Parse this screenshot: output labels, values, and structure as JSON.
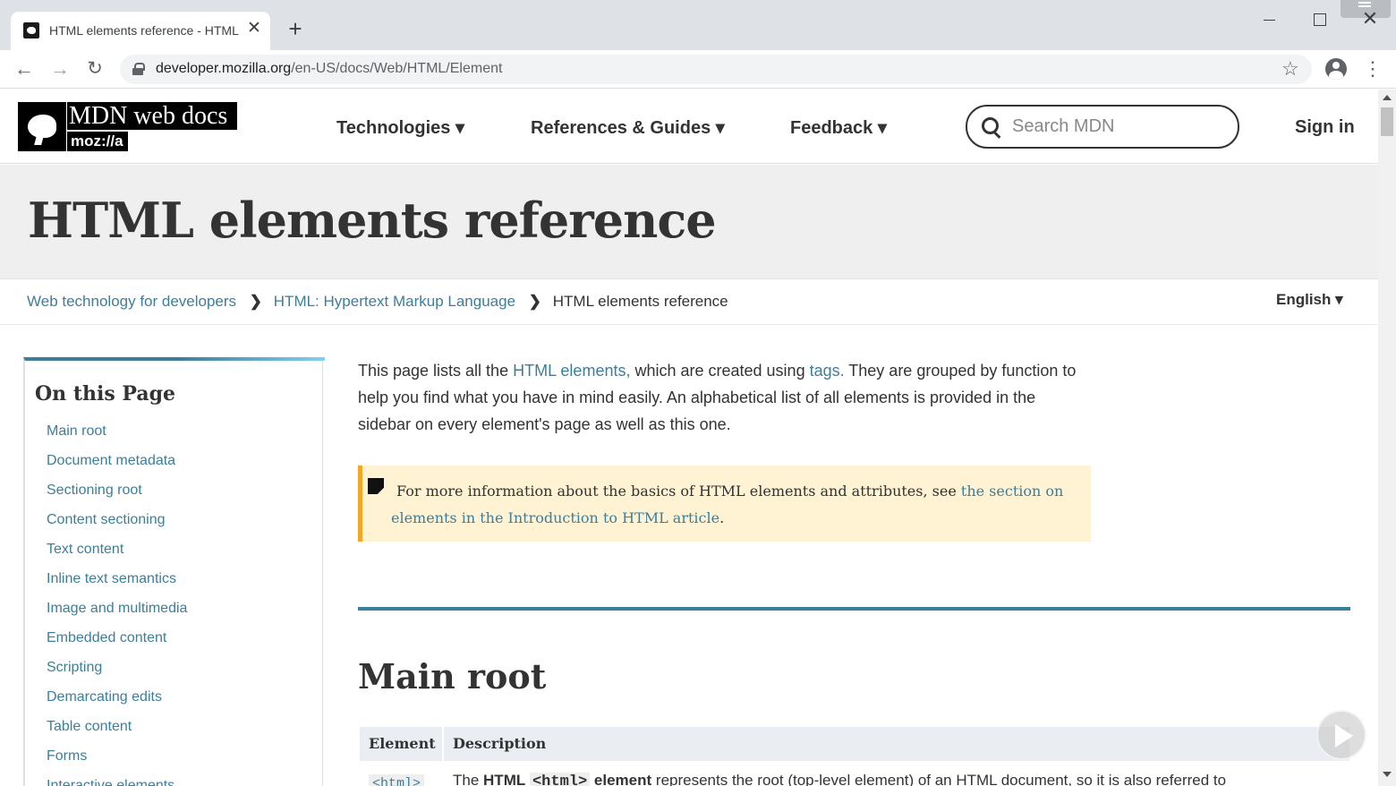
{
  "browser": {
    "tab_title": "HTML elements reference - HTML",
    "tab_close": "✕",
    "new_tab": "+",
    "url_host": "developer.mozilla.org",
    "url_path": "/en-US/docs/Web/HTML/Element",
    "icons": {
      "back": "arrow-left-icon",
      "forward": "arrow-right-icon",
      "reload": "reload-icon",
      "lock": "lock-icon",
      "star": "star-icon",
      "profile": "profile-icon",
      "menu": "kebab-menu-icon"
    },
    "glyphs": {
      "back": "←",
      "forward": "→",
      "reload": "↻",
      "star": "☆",
      "menu": "⋮",
      "close": "✕"
    }
  },
  "header": {
    "logo_title": "MDN web docs",
    "logo_moz": "moz://a",
    "nav": {
      "technologies": "Technologies ▾",
      "references": "References & Guides ▾",
      "feedback": "Feedback ▾"
    },
    "search_placeholder": "Search MDN",
    "sign_in": "Sign in"
  },
  "page": {
    "title": "HTML elements reference",
    "breadcrumb": {
      "item1": "Web technology for developers",
      "item2": "HTML: Hypertext Markup Language",
      "current": "HTML elements reference",
      "sep": "❯"
    },
    "language": "English ▾"
  },
  "toc": {
    "heading": "On this Page",
    "items": [
      "Main root",
      "Document metadata",
      "Sectioning root",
      "Content sectioning",
      "Text content",
      "Inline text semantics",
      "Image and multimedia",
      "Embedded content",
      "Scripting",
      "Demarcating edits",
      "Table content",
      "Forms",
      "Interactive elements"
    ]
  },
  "content": {
    "intro": {
      "p1": "This page lists all the ",
      "link1": "HTML elements,",
      "p2": " which are created using ",
      "link2": "tags.",
      "p3": " They are grouped by function to help you find what you have in mind easily. An alphabetical list of all elements is provided in the sidebar on every element's page as well as this one."
    },
    "note": {
      "text": "For more information about the basics of HTML elements and attributes, see ",
      "link": "the section on elements in the Introduction to HTML article",
      "end": "."
    },
    "section_heading": "Main root",
    "table": {
      "headers": [
        "Element",
        "Description"
      ],
      "row1": {
        "element": "<html>",
        "desc_pre": "The ",
        "desc_bold": "HTML",
        "desc_code": "<html>",
        "desc_bold2": " element",
        "desc_post": " represents the root (top-level element) of an HTML document, so it is also referred to"
      }
    }
  },
  "colors": {
    "link": "#3d7e9a",
    "note_bg": "#fff3d4",
    "note_border": "#f5a623",
    "title_band": "#efefef"
  }
}
